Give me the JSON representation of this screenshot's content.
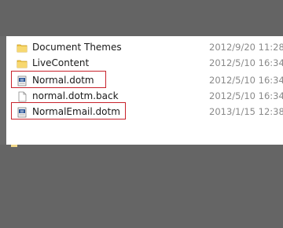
{
  "files": [
    {
      "name": "Document Themes",
      "date": "2012/9/20 11:28",
      "type": "folder-icon"
    },
    {
      "name": "LiveContent",
      "date": "2012/5/10 16:34",
      "type": "folder-icon"
    },
    {
      "name": "Normal.dotm",
      "date": "2012/5/10 16:34",
      "type": "word-template-icon"
    },
    {
      "name": "normal.dotm.back",
      "date": "2012/5/10 16:34",
      "type": "file-icon"
    },
    {
      "name": "NormalEmail.dotm",
      "date": "2013/1/15 12:38",
      "type": "word-template-icon"
    }
  ],
  "colors": {
    "highlight": "#c8232c",
    "folder": "#f2c94c",
    "date_text": "#8a8a8a"
  }
}
